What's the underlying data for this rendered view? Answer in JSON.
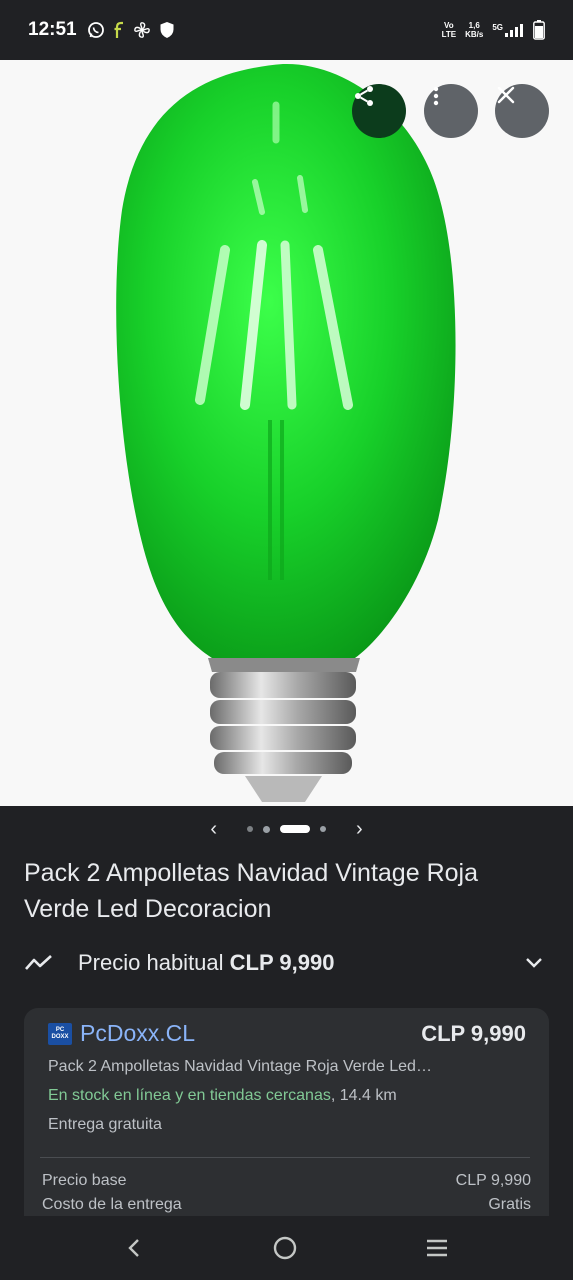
{
  "status_bar": {
    "time": "12:51",
    "left_icons": [
      "whatsapp-icon",
      "f-app-icon",
      "fan-icon",
      "shield-icon"
    ],
    "network_top": "Vo",
    "network_bottom": "LTE",
    "speed_top": "1,6",
    "speed_bottom": "KB/s",
    "signal_type": "5G"
  },
  "image_actions": [
    "share-icon",
    "more-vert-icon",
    "close-icon"
  ],
  "carousel": {
    "dots": 4,
    "active_index": 2
  },
  "product": {
    "title": "Pack 2 Ampolletas Navidad Vintage Roja Verde Led Decoracion"
  },
  "price_history": {
    "label": "Precio habitual",
    "value": "CLP 9,990"
  },
  "offer": {
    "merchant": "PcDoxx.CL",
    "logo_top": "PC",
    "logo_bottom": "DOXX",
    "price": "CLP 9,990",
    "description": "Pack 2 Ampolletas Navidad Vintage Roja Verde Led…",
    "stock_text": "En stock en línea y en tiendas cercanas",
    "distance": ", 14.4 km",
    "delivery": "Entrega gratuita",
    "breakdown": [
      {
        "label": "Precio base",
        "value": "CLP 9,990"
      },
      {
        "label": "Costo de la entrega",
        "value": "Gratis"
      }
    ]
  },
  "colors": {
    "bulb_green": "#17d12a",
    "link_blue": "#8ab4f8",
    "stock_green": "#81c995",
    "background": "#202124"
  }
}
